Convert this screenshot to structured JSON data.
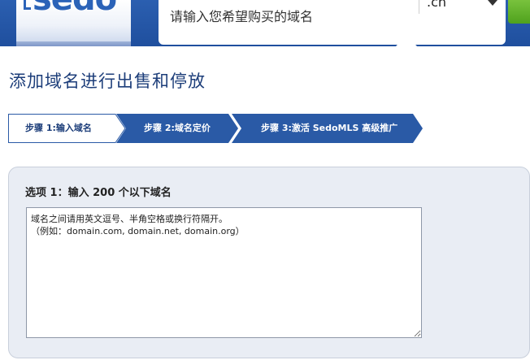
{
  "header": {
    "logo_text": "sedo",
    "search": {
      "placeholder": "请输入您希望购买的域名"
    },
    "tld_select": {
      "value": ".cn"
    },
    "colors": {
      "header_bg": "#2356a8",
      "search_button": "#5aab27"
    }
  },
  "page": {
    "title": "添加域名进行出售和停放"
  },
  "steps": [
    {
      "label": "步骤 1:输入域名",
      "state": "active"
    },
    {
      "label": "步骤 2:域名定价",
      "state": "inactive"
    },
    {
      "label": "步骤 3:激活 SedoMLS 高级推广",
      "state": "inactive"
    }
  ],
  "option": {
    "heading": "选项 1：输入 200 个以下域名",
    "textarea_placeholder": "域名之间请用英文逗号、半角空格或换行符隔开。\n（例如：domain.com, domain.net, domain.org）"
  }
}
